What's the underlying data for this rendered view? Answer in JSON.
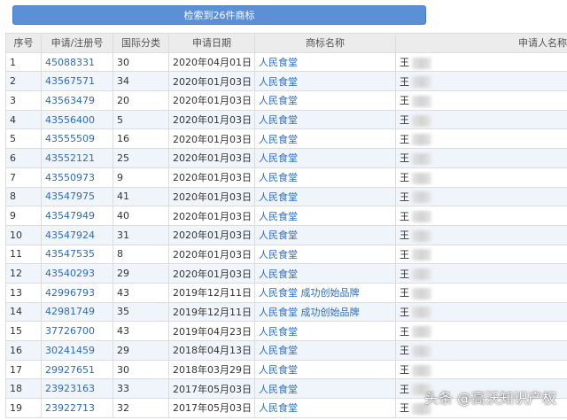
{
  "banner": {
    "label": "检索到26件商标"
  },
  "table": {
    "headers": [
      "序号",
      "申请/注册号",
      "国际分类",
      "申请日期",
      "商标名称",
      "申请人名称"
    ],
    "rows": [
      {
        "no": "1",
        "reg": "45088331",
        "cls": "30",
        "date": "2020年04月01日",
        "name": "人民食堂",
        "applicant": "王"
      },
      {
        "no": "2",
        "reg": "43567571",
        "cls": "34",
        "date": "2020年01月03日",
        "name": "人民食堂",
        "applicant": "王"
      },
      {
        "no": "3",
        "reg": "43563479",
        "cls": "20",
        "date": "2020年01月03日",
        "name": "人民食堂",
        "applicant": "王"
      },
      {
        "no": "4",
        "reg": "43556400",
        "cls": "5",
        "date": "2020年01月03日",
        "name": "人民食堂",
        "applicant": "王"
      },
      {
        "no": "5",
        "reg": "43555509",
        "cls": "16",
        "date": "2020年01月03日",
        "name": "人民食堂",
        "applicant": "王"
      },
      {
        "no": "6",
        "reg": "43552121",
        "cls": "25",
        "date": "2020年01月03日",
        "name": "人民食堂",
        "applicant": "王"
      },
      {
        "no": "7",
        "reg": "43550973",
        "cls": "9",
        "date": "2020年01月03日",
        "name": "人民食堂",
        "applicant": "王"
      },
      {
        "no": "8",
        "reg": "43547975",
        "cls": "41",
        "date": "2020年01月03日",
        "name": "人民食堂",
        "applicant": "王"
      },
      {
        "no": "9",
        "reg": "43547949",
        "cls": "40",
        "date": "2020年01月03日",
        "name": "人民食堂",
        "applicant": "王"
      },
      {
        "no": "10",
        "reg": "43547924",
        "cls": "31",
        "date": "2020年01月03日",
        "name": "人民食堂",
        "applicant": "王"
      },
      {
        "no": "11",
        "reg": "43547535",
        "cls": "8",
        "date": "2020年01月03日",
        "name": "人民食堂",
        "applicant": "王"
      },
      {
        "no": "12",
        "reg": "43540293",
        "cls": "29",
        "date": "2020年01月03日",
        "name": "人民食堂",
        "applicant": "王"
      },
      {
        "no": "13",
        "reg": "42996793",
        "cls": "43",
        "date": "2019年12月11日",
        "name": "人民食堂 成功创始品牌",
        "applicant": "王"
      },
      {
        "no": "14",
        "reg": "42981749",
        "cls": "35",
        "date": "2019年12月11日",
        "name": "人民食堂 成功创始品牌",
        "applicant": "王"
      },
      {
        "no": "15",
        "reg": "37726700",
        "cls": "43",
        "date": "2019年04月23日",
        "name": "人民食堂",
        "applicant": "王"
      },
      {
        "no": "16",
        "reg": "30241459",
        "cls": "29",
        "date": "2018年04月13日",
        "name": "人民食堂",
        "applicant": "王"
      },
      {
        "no": "17",
        "reg": "29927651",
        "cls": "30",
        "date": "2018年03月29日",
        "name": "人民食堂",
        "applicant": "王"
      },
      {
        "no": "18",
        "reg": "23923163",
        "cls": "33",
        "date": "2017年05月03日",
        "name": "人民食堂",
        "applicant": "王"
      },
      {
        "no": "19",
        "reg": "23922713",
        "cls": "32",
        "date": "2017年05月03日",
        "name": "人民食堂",
        "applicant": "王"
      }
    ]
  },
  "watermark": {
    "text": "头条 @高沃知识产权"
  }
}
